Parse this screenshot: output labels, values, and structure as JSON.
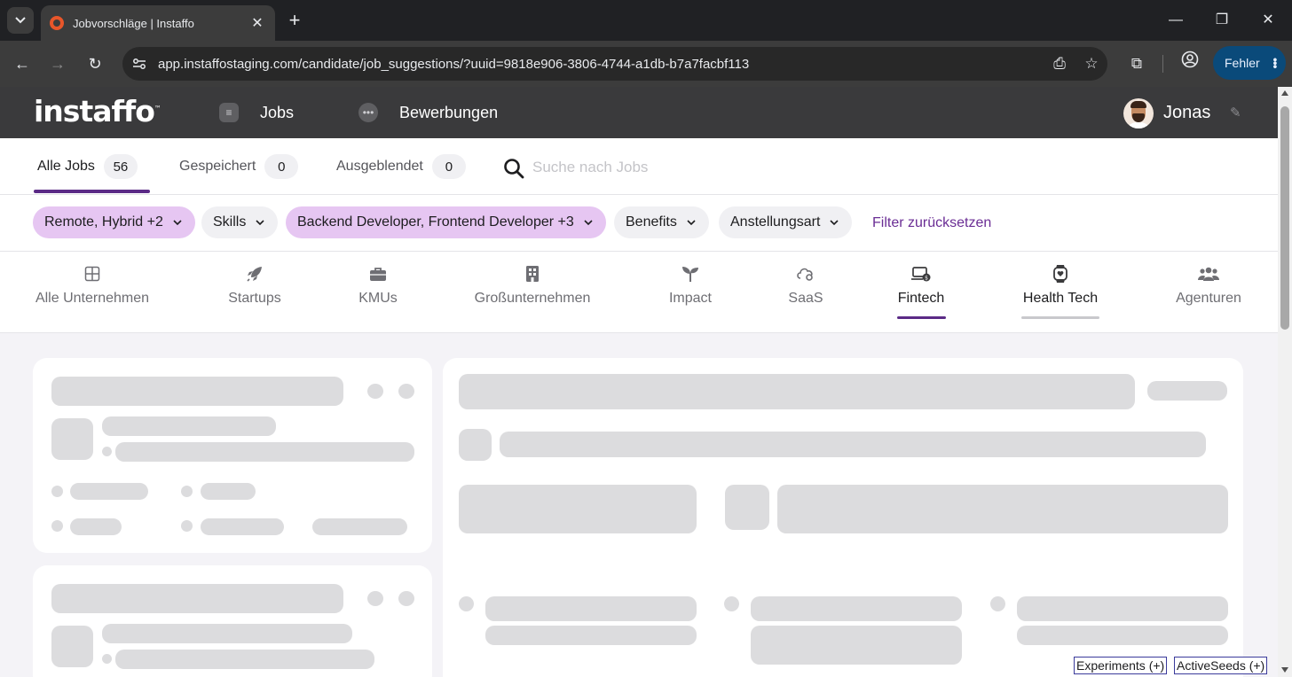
{
  "browser": {
    "tab_title": "Jobvorschläge | Instaffo",
    "url": "app.instaffostaging.com/candidate/job_suggestions/?uuid=9818e906-3806-4744-a1db-b7a7facbf113",
    "error_button_label": "Fehler"
  },
  "header": {
    "logo": "instaffo",
    "logo_mark": "™",
    "nav": [
      {
        "label": "Jobs",
        "icon": "document-icon"
      },
      {
        "label": "Bewerbungen",
        "icon": "chat-bubble-icon"
      }
    ],
    "user_name": "Jonas"
  },
  "job_tabs": [
    {
      "label": "Alle Jobs",
      "count": "56",
      "active": true
    },
    {
      "label": "Gespeichert",
      "count": "0",
      "active": false
    },
    {
      "label": "Ausgeblendet",
      "count": "0",
      "active": false
    }
  ],
  "search": {
    "placeholder": "Suche nach Jobs",
    "value": ""
  },
  "filters": [
    {
      "label": "Remote, Hybrid +2",
      "selected": true
    },
    {
      "label": "Skills",
      "selected": false
    },
    {
      "label": "Backend Developer, Frontend Developer +3",
      "selected": true
    },
    {
      "label": "Benefits",
      "selected": false
    },
    {
      "label": "Anstellungsart",
      "selected": false
    }
  ],
  "filter_reset_label": "Filter zurücksetzen",
  "categories": [
    {
      "label": "Alle Unternehmen",
      "icon": "grid-icon"
    },
    {
      "label": "Startups",
      "icon": "rocket-icon"
    },
    {
      "label": "KMUs",
      "icon": "briefcase-icon"
    },
    {
      "label": "Großunternehmen",
      "icon": "building-icon"
    },
    {
      "label": "Impact",
      "icon": "sprout-icon"
    },
    {
      "label": "SaaS",
      "icon": "cloud-gear-icon"
    },
    {
      "label": "Fintech",
      "icon": "laptop-coin-icon",
      "state": "active"
    },
    {
      "label": "Health Tech",
      "icon": "smartwatch-icon",
      "state": "hover"
    },
    {
      "label": "Agenturen",
      "icon": "people-icon"
    }
  ],
  "colors": {
    "brand_purple": "#5b2a86",
    "chip_selected": "#e6c6f2",
    "skeleton": "#dcdcde",
    "header_bg": "#3a3a3c"
  },
  "debug": {
    "experiments": "Experiments (+)",
    "active_seeds": "ActiveSeeds (+)"
  }
}
